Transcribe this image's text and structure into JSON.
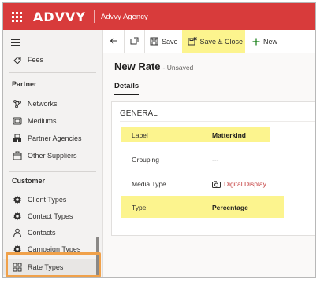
{
  "app": {
    "brand": "ADVVY",
    "name": "Advvy Agency"
  },
  "sidebar": {
    "top_items": [
      {
        "label": "Fees",
        "icon": "fees-icon"
      }
    ],
    "groups": [
      {
        "title": "Partner",
        "items": [
          {
            "label": "Networks",
            "icon": "network-icon"
          },
          {
            "label": "Mediums",
            "icon": "medium-icon"
          },
          {
            "label": "Partner Agencies",
            "icon": "building-icon"
          },
          {
            "label": "Other Suppliers",
            "icon": "supplier-icon"
          }
        ]
      },
      {
        "title": "Customer",
        "items": [
          {
            "label": "Client Types",
            "icon": "gear-icon"
          },
          {
            "label": "Contact Types",
            "icon": "gear-icon"
          },
          {
            "label": "Contacts",
            "icon": "person-icon"
          },
          {
            "label": "Campaign Types",
            "icon": "gear-icon"
          },
          {
            "label": "Rate Types",
            "icon": "grid-icon",
            "selected": true
          }
        ]
      }
    ]
  },
  "commandbar": {
    "save": "Save",
    "save_close": "Save & Close",
    "new": "New"
  },
  "form": {
    "title": "New Rate",
    "status": "- Unsaved",
    "tab": "Details",
    "section": "GENERAL",
    "fields": [
      {
        "label": "Label",
        "value": "Matterkind"
      },
      {
        "label": "Grouping",
        "value": "---"
      },
      {
        "label": "Media Type",
        "value": "Digital Display"
      },
      {
        "label": "Type",
        "value": "Percentage"
      }
    ]
  },
  "colors": {
    "topbar": "#d83b3b",
    "highlight_yellow": "#fbf27a",
    "highlight_orange": "#f0a14a",
    "link_red": "#c43d3d"
  }
}
